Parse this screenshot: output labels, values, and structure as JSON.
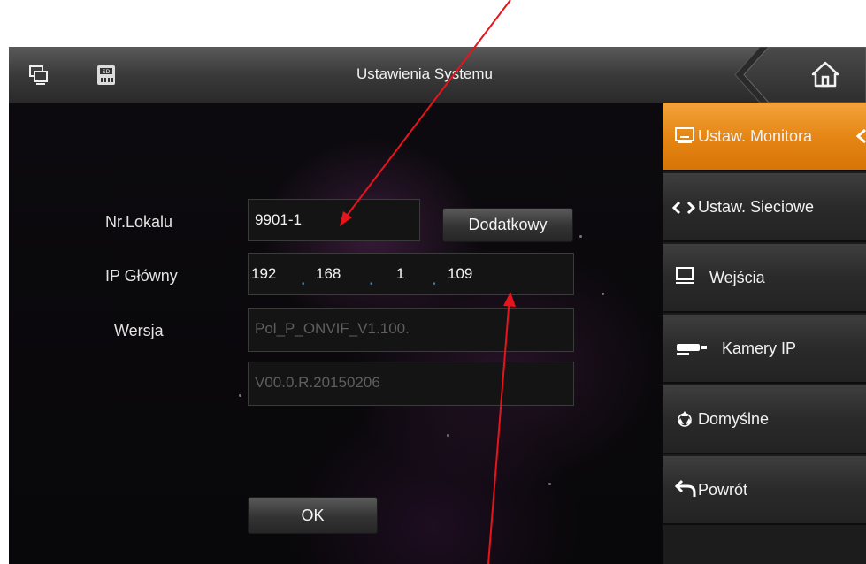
{
  "header": {
    "title": "Ustawienia Systemu",
    "left_icons": [
      "monitor-icon",
      "sd-card-icon"
    ],
    "home_icon": "home-icon"
  },
  "form": {
    "room": {
      "label": "Nr.Lokalu",
      "value": "9901-1"
    },
    "advanced_button": "Dodatkowy",
    "ip": {
      "label": "IP Główny",
      "octets": [
        "192",
        "168",
        "1",
        "109"
      ]
    },
    "version": {
      "label": "Wersja",
      "line1": "Pol_P_ONVIF_V1.100.",
      "line2": "V00.0.R.20150206"
    },
    "ok_button": "OK"
  },
  "sidebar": {
    "items": [
      {
        "label": "Ustaw. Monitora",
        "icon": "monitor-icon",
        "active": true
      },
      {
        "label": "Ustaw. Sieciowe",
        "icon": "network-arrows-icon",
        "active": false
      },
      {
        "label": "Wejścia",
        "icon": "monitor-icon",
        "active": false
      },
      {
        "label": "Kamery IP",
        "icon": "camera-icon",
        "active": false
      },
      {
        "label": "Domyślne",
        "icon": "recycle-icon",
        "active": false
      },
      {
        "label": "Powrót",
        "icon": "back-arrow-icon",
        "active": false
      }
    ]
  },
  "colors": {
    "accent": "#e48412",
    "annotation": "#e8141b"
  }
}
